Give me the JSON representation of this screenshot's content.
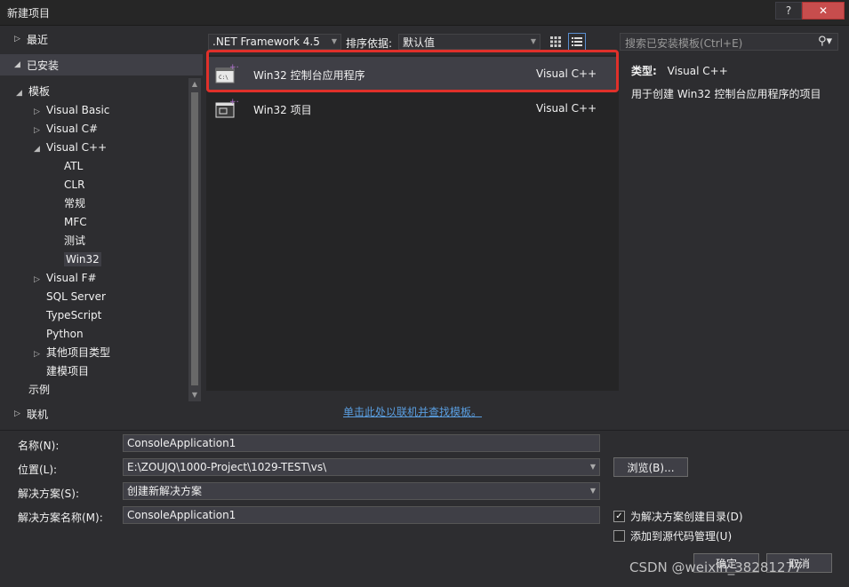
{
  "window": {
    "title": "新建项目",
    "help_label": "?"
  },
  "left_nav": {
    "recent": "最近",
    "installed": "已安装",
    "online": "联机",
    "tree": [
      {
        "label": "模板",
        "arrow": "◢",
        "indent": 0
      },
      {
        "label": "Visual Basic",
        "arrow": "▷",
        "indent": 1
      },
      {
        "label": "Visual C#",
        "arrow": "▷",
        "indent": 1
      },
      {
        "label": "Visual C++",
        "arrow": "◢",
        "indent": 1
      },
      {
        "label": "ATL",
        "arrow": "",
        "indent": 2
      },
      {
        "label": "CLR",
        "arrow": "",
        "indent": 2
      },
      {
        "label": "常规",
        "arrow": "",
        "indent": 2
      },
      {
        "label": "MFC",
        "arrow": "",
        "indent": 2
      },
      {
        "label": "测试",
        "arrow": "",
        "indent": 2
      },
      {
        "label": "Win32",
        "arrow": "",
        "indent": 2,
        "selected": true
      },
      {
        "label": "Visual F#",
        "arrow": "▷",
        "indent": 1
      },
      {
        "label": "SQL Server",
        "arrow": "",
        "indent": 1
      },
      {
        "label": "TypeScript",
        "arrow": "",
        "indent": 1
      },
      {
        "label": "Python",
        "arrow": "",
        "indent": 1
      },
      {
        "label": "其他项目类型",
        "arrow": "▷",
        "indent": 1
      },
      {
        "label": "建模项目",
        "arrow": "",
        "indent": 1
      },
      {
        "label": "示例",
        "arrow": "",
        "indent": 0
      }
    ]
  },
  "toolbar": {
    "framework": ".NET Framework 4.5",
    "sort_label": "排序依据:",
    "sort_value": "默认值"
  },
  "templates": [
    {
      "name": "Win32 控制台应用程序",
      "lang": "Visual C++",
      "selected": true
    },
    {
      "name": "Win32 项目",
      "lang": "Visual C++",
      "selected": false
    }
  ],
  "online_link": "单击此处以联机并查找模板。",
  "search": {
    "placeholder": "搜索已安装模板(Ctrl+E)"
  },
  "info": {
    "type_label": "类型:",
    "type_value": "Visual C++",
    "description": "用于创建 Win32 控制台应用程序的项目"
  },
  "form": {
    "name_label": "名称(N):",
    "name_value": "ConsoleApplication1",
    "location_label": "位置(L):",
    "location_value": "E:\\ZOUJQ\\1000-Project\\1029-TEST\\vs\\",
    "solution_label": "解决方案(S):",
    "solution_value": "创建新解决方案",
    "solution_name_label": "解决方案名称(M):",
    "solution_name_value": "ConsoleApplication1",
    "browse_label": "浏览(B)...",
    "create_dir_label": "为解决方案创建目录(D)",
    "create_dir_checked": true,
    "source_control_label": "添加到源代码管理(U)",
    "source_control_checked": false,
    "ok_label": "确定",
    "cancel_label": "取消"
  },
  "watermark": "CSDN @weixin_38281277",
  "colors": {
    "highlight_border": "#e0302a",
    "link": "#5a9ee0",
    "close_button": "#c74d4d"
  }
}
